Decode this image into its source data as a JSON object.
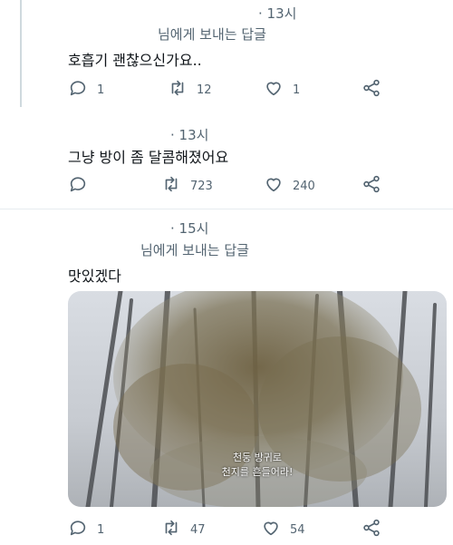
{
  "colors": {
    "text": "#0f1419",
    "muted": "#536471",
    "line": "#cfd9de",
    "divider": "#e6ecf0"
  },
  "tweets": [
    {
      "time": "· 13시",
      "reply_to": "님에게 보내는 답글",
      "text": "호흡기 괜찮으신가요..",
      "replies": "1",
      "retweets": "12",
      "likes": "1"
    },
    {
      "time": "· 13시",
      "text": "그냥 방이 좀 달콤해졌어요",
      "replies": "",
      "retweets": "723",
      "likes": "240"
    },
    {
      "time": "· 15시",
      "reply_to": "님에게 보내는 답글",
      "text": "맛있겠다",
      "media_caption_1": "천둥 방귀로",
      "media_caption_2": "천지를 흔들어라!",
      "replies": "1",
      "retweets": "47",
      "likes": "54"
    }
  ],
  "icons": [
    "reply-icon",
    "retweet-icon",
    "like-icon",
    "share-icon"
  ]
}
